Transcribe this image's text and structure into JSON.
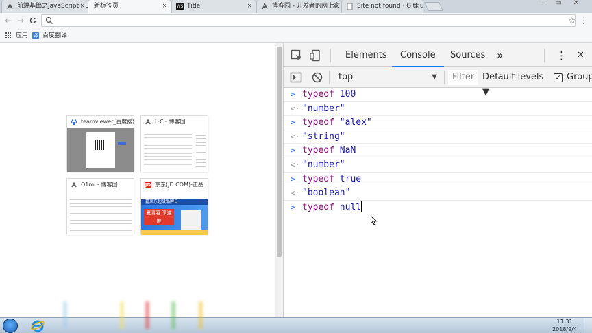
{
  "browser": {
    "tabs": [
      {
        "label": "前端基础之JavaScript - L",
        "favicon": "cnblogs-icon",
        "active": false
      },
      {
        "label": "新标签页",
        "favicon": "",
        "active": true
      },
      {
        "label": "Title",
        "favicon": "webstorm-icon",
        "active": false
      },
      {
        "label": "博客园 - 开发者的网上家",
        "favicon": "cnblogs-icon",
        "active": false
      },
      {
        "label": "Site not found · GitHub",
        "favicon": "page-icon",
        "active": false
      }
    ],
    "close_glyph": "×",
    "window_controls": {
      "minimize": "—",
      "maximize": "▭",
      "close": "✕"
    },
    "toolbar": {
      "back": "←",
      "forward": "→",
      "reload": "C",
      "omnibox_value": "",
      "star": "☆",
      "menu": "⋮"
    },
    "bookmarks": [
      {
        "label": "应用",
        "icon": "apps-grid-icon"
      },
      {
        "label": "百度翻译",
        "icon": "translate-icon"
      }
    ]
  },
  "new_tab_page": {
    "tiles": [
      {
        "title": "teamviewer_百度搜索",
        "favicon": "baidu-paw-icon"
      },
      {
        "title": "L·C - 博客园",
        "favicon": "cnblogs-icon"
      },
      {
        "title": "Q1mi - 博客园",
        "favicon": "cnblogs-icon"
      },
      {
        "title": "京东(JD.COM)-正品",
        "favicon": "jd-icon"
      }
    ],
    "jd_banner_text": "夏青春 享速度",
    "jd_strip_text": "嘉京东超级品牌日"
  },
  "devtools": {
    "tabs": [
      {
        "label": "Elements",
        "active": false
      },
      {
        "label": "Console",
        "active": true
      },
      {
        "label": "Sources",
        "active": false
      }
    ],
    "more_tabs": "»",
    "menu": "⋮",
    "close": "✕",
    "context": "top",
    "filter_placeholder": "Filter",
    "levels": "Default levels ▼",
    "group_label": "Group",
    "group_checked": true,
    "console": [
      {
        "kind": "in",
        "keyword": "typeof",
        "rest": " 100"
      },
      {
        "kind": "out",
        "text": "\"number\""
      },
      {
        "kind": "in",
        "keyword": "typeof",
        "rest": " \"alex\""
      },
      {
        "kind": "out",
        "text": "\"string\""
      },
      {
        "kind": "in",
        "keyword": "typeof",
        "rest": " NaN"
      },
      {
        "kind": "out",
        "text": "\"number\""
      },
      {
        "kind": "in",
        "keyword": "typeof",
        "rest": " true"
      },
      {
        "kind": "out",
        "text": "\"boolean\""
      }
    ],
    "prompt": {
      "keyword": "typeof",
      "rest": " null"
    },
    "glyphs": {
      "input": ">",
      "output": "<·"
    }
  },
  "taskbar": {
    "time": "11:31",
    "date": "2018/9/4"
  }
}
